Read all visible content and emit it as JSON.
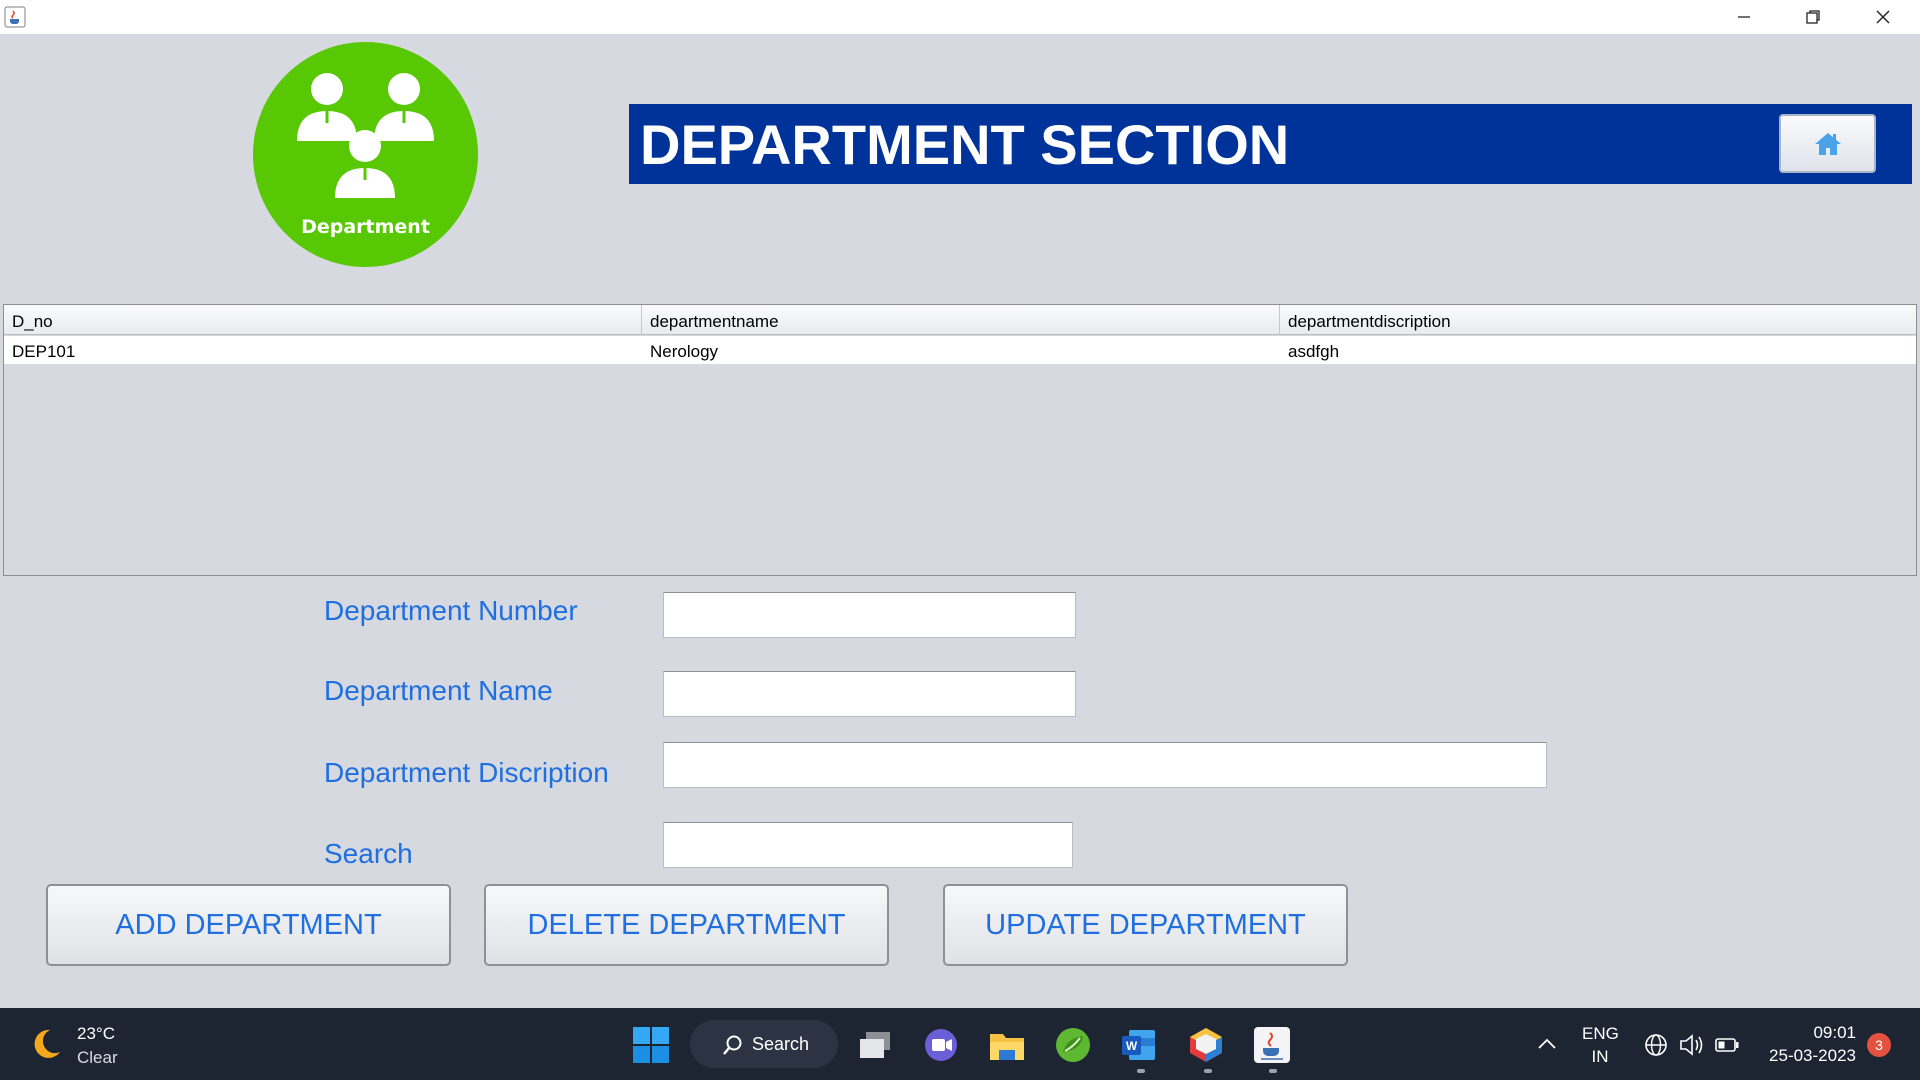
{
  "window": {
    "app_icon": "java-cup-icon",
    "controls": [
      "minimize-icon",
      "restore-icon",
      "close-icon"
    ]
  },
  "logo": {
    "label": "Department",
    "icon": "people-group-icon"
  },
  "header": {
    "title": "DEPARTMENT SECTION",
    "home_icon": "home-icon"
  },
  "table": {
    "columns": [
      "D_no",
      "departmentname",
      "departmentdiscription"
    ],
    "rows": [
      [
        "DEP101",
        "Nerology",
        "asdfgh"
      ]
    ]
  },
  "form": {
    "department_number": {
      "label": "Department Number",
      "value": ""
    },
    "department_name": {
      "label": "Department Name",
      "value": ""
    },
    "department_description": {
      "label": "Department Discription",
      "value": ""
    },
    "search": {
      "label": "Search",
      "value": ""
    }
  },
  "buttons": {
    "add": "ADD DEPARTMENT",
    "delete": "DELETE DEPARTMENT",
    "update": "UPDATE DEPARTMENT"
  },
  "taskbar": {
    "weather": {
      "temp": "23°C",
      "condition": "Clear",
      "icon": "moon-icon"
    },
    "search_label": "Search",
    "apps": [
      "windows-start-icon",
      "search-icon",
      "task-view-icon",
      "teams-icon",
      "file-explorer-icon",
      "spring-icon",
      "word-icon",
      "netbeans-icon",
      "java-icon"
    ],
    "language": {
      "line1": "ENG",
      "line2": "IN"
    },
    "clock": {
      "time": "09:01",
      "date": "25-03-2023"
    },
    "notification_count": "3"
  }
}
